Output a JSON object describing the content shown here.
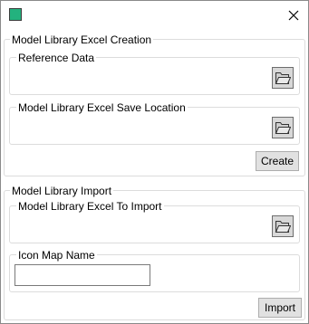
{
  "window": {
    "accent_color": "#23b27e"
  },
  "creation": {
    "title": "Model Library Excel Creation",
    "reference_data": {
      "label": "Reference Data"
    },
    "save_location": {
      "label": "Model Library Excel Save Location"
    },
    "create_label": "Create"
  },
  "import_section": {
    "title": "Model Library Import",
    "excel_to_import": {
      "label": "Model Library Excel To Import"
    },
    "icon_map": {
      "label": "Icon Map Name",
      "value": ""
    },
    "import_label": "Import"
  },
  "icons": {
    "app": "app-icon",
    "close": "close-icon",
    "browse": "folder-icon"
  }
}
